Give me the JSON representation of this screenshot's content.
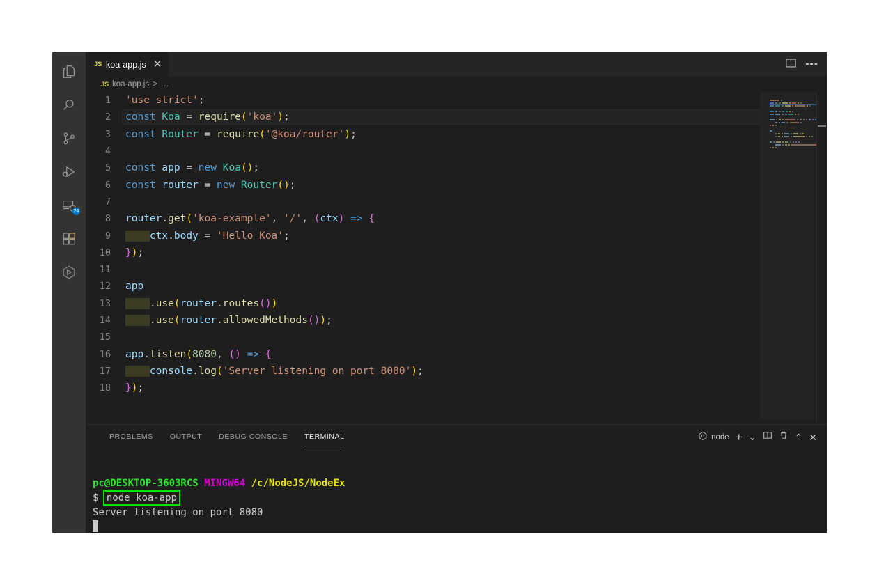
{
  "window": {
    "background": "#1e1e1e",
    "accent": "#007acc"
  },
  "activity_bar": {
    "items": [
      {
        "name": "explorer",
        "icon": "files-icon",
        "badge": ""
      },
      {
        "name": "search",
        "icon": "search-icon",
        "badge": ""
      },
      {
        "name": "source-control",
        "icon": "source-control-icon",
        "badge": ""
      },
      {
        "name": "run-and-debug",
        "icon": "run-debug-icon",
        "badge": ""
      },
      {
        "name": "remote-explorer",
        "icon": "remote-explorer-icon",
        "badge": "24"
      },
      {
        "name": "extensions",
        "icon": "extensions-icon",
        "badge": ""
      },
      {
        "name": "node-dependencies",
        "icon": "hexagon-node-icon",
        "badge": ""
      }
    ]
  },
  "tabbar": {
    "tabs": [
      {
        "label": "koa-app.js",
        "file_type": "JS",
        "active": true,
        "close_glyph": "✕"
      }
    ],
    "actions": {
      "split_editor": "split-editor-icon",
      "more_actions": "•••"
    }
  },
  "breadcrumb": {
    "file_type": "JS",
    "file": "koa-app.js",
    "separator": ">",
    "overflow": "…"
  },
  "editor": {
    "language": "javascript",
    "current_line": 2,
    "total_lines": 18,
    "lines": [
      {
        "n": "1",
        "tokens": [
          {
            "t": "'use strict'",
            "c": "t-str"
          },
          {
            "t": ";",
            "c": "t-plain"
          }
        ]
      },
      {
        "n": "2",
        "current": true,
        "tokens": [
          {
            "t": "const",
            "c": "t-kw"
          },
          {
            "t": " ",
            "c": "t-plain"
          },
          {
            "t": "Koa",
            "c": "t-cls"
          },
          {
            "t": " = ",
            "c": "t-op"
          },
          {
            "t": "require",
            "c": "t-fn"
          },
          {
            "t": "(",
            "c": "t-p1"
          },
          {
            "t": "'koa'",
            "c": "t-str"
          },
          {
            "t": ")",
            "c": "t-p1"
          },
          {
            "t": ";",
            "c": "t-plain"
          }
        ]
      },
      {
        "n": "3",
        "tokens": [
          {
            "t": "const",
            "c": "t-kw"
          },
          {
            "t": " ",
            "c": "t-plain"
          },
          {
            "t": "Router",
            "c": "t-cls"
          },
          {
            "t": " = ",
            "c": "t-op"
          },
          {
            "t": "require",
            "c": "t-fn"
          },
          {
            "t": "(",
            "c": "t-p1"
          },
          {
            "t": "'@koa/router'",
            "c": "t-str"
          },
          {
            "t": ")",
            "c": "t-p1"
          },
          {
            "t": ";",
            "c": "t-plain"
          }
        ]
      },
      {
        "n": "4",
        "tokens": []
      },
      {
        "n": "5",
        "tokens": [
          {
            "t": "const",
            "c": "t-kw"
          },
          {
            "t": " ",
            "c": "t-plain"
          },
          {
            "t": "app",
            "c": "t-var"
          },
          {
            "t": " = ",
            "c": "t-op"
          },
          {
            "t": "new",
            "c": "t-kw"
          },
          {
            "t": " ",
            "c": "t-plain"
          },
          {
            "t": "Koa",
            "c": "t-cls"
          },
          {
            "t": "()",
            "c": "t-p1"
          },
          {
            "t": ";",
            "c": "t-plain"
          }
        ]
      },
      {
        "n": "6",
        "tokens": [
          {
            "t": "const",
            "c": "t-kw"
          },
          {
            "t": " ",
            "c": "t-plain"
          },
          {
            "t": "router",
            "c": "t-var"
          },
          {
            "t": " = ",
            "c": "t-op"
          },
          {
            "t": "new",
            "c": "t-kw"
          },
          {
            "t": " ",
            "c": "t-plain"
          },
          {
            "t": "Router",
            "c": "t-cls"
          },
          {
            "t": "()",
            "c": "t-p1"
          },
          {
            "t": ";",
            "c": "t-plain"
          }
        ]
      },
      {
        "n": "7",
        "tokens": []
      },
      {
        "n": "8",
        "tokens": [
          {
            "t": "router",
            "c": "t-var"
          },
          {
            "t": ".",
            "c": "t-plain"
          },
          {
            "t": "get",
            "c": "t-fn"
          },
          {
            "t": "(",
            "c": "t-p1"
          },
          {
            "t": "'koa-example'",
            "c": "t-str"
          },
          {
            "t": ", ",
            "c": "t-plain"
          },
          {
            "t": "'/'",
            "c": "t-str"
          },
          {
            "t": ", ",
            "c": "t-plain"
          },
          {
            "t": "(",
            "c": "t-p2"
          },
          {
            "t": "ctx",
            "c": "t-var"
          },
          {
            "t": ")",
            "c": "t-p2"
          },
          {
            "t": " ",
            "c": "t-plain"
          },
          {
            "t": "=>",
            "c": "t-kw"
          },
          {
            "t": " ",
            "c": "t-plain"
          },
          {
            "t": "{",
            "c": "t-p2"
          }
        ]
      },
      {
        "n": "9",
        "indent": 1,
        "tokens": [
          {
            "t": "ctx",
            "c": "t-var"
          },
          {
            "t": ".",
            "c": "t-plain"
          },
          {
            "t": "body",
            "c": "t-var"
          },
          {
            "t": " = ",
            "c": "t-op"
          },
          {
            "t": "'Hello Koa'",
            "c": "t-str"
          },
          {
            "t": ";",
            "c": "t-plain"
          }
        ]
      },
      {
        "n": "10",
        "tokens": [
          {
            "t": "}",
            "c": "t-p2"
          },
          {
            "t": ")",
            "c": "t-p1"
          },
          {
            "t": ";",
            "c": "t-plain"
          }
        ]
      },
      {
        "n": "11",
        "tokens": []
      },
      {
        "n": "12",
        "tokens": [
          {
            "t": "app",
            "c": "t-var"
          }
        ]
      },
      {
        "n": "13",
        "indent": 1,
        "tokens": [
          {
            "t": ".",
            "c": "t-plain"
          },
          {
            "t": "use",
            "c": "t-fn"
          },
          {
            "t": "(",
            "c": "t-p1"
          },
          {
            "t": "router",
            "c": "t-var"
          },
          {
            "t": ".",
            "c": "t-plain"
          },
          {
            "t": "routes",
            "c": "t-fn"
          },
          {
            "t": "()",
            "c": "t-p2"
          },
          {
            "t": ")",
            "c": "t-p1"
          }
        ]
      },
      {
        "n": "14",
        "indent": 1,
        "tokens": [
          {
            "t": ".",
            "c": "t-plain"
          },
          {
            "t": "use",
            "c": "t-fn"
          },
          {
            "t": "(",
            "c": "t-p1"
          },
          {
            "t": "router",
            "c": "t-var"
          },
          {
            "t": ".",
            "c": "t-plain"
          },
          {
            "t": "allowedMethods",
            "c": "t-fn"
          },
          {
            "t": "()",
            "c": "t-p2"
          },
          {
            "t": ")",
            "c": "t-p1"
          },
          {
            "t": ";",
            "c": "t-plain"
          }
        ]
      },
      {
        "n": "15",
        "tokens": []
      },
      {
        "n": "16",
        "tokens": [
          {
            "t": "app",
            "c": "t-var"
          },
          {
            "t": ".",
            "c": "t-plain"
          },
          {
            "t": "listen",
            "c": "t-fn"
          },
          {
            "t": "(",
            "c": "t-p1"
          },
          {
            "t": "8080",
            "c": "t-num"
          },
          {
            "t": ", ",
            "c": "t-plain"
          },
          {
            "t": "()",
            "c": "t-p2"
          },
          {
            "t": " ",
            "c": "t-plain"
          },
          {
            "t": "=>",
            "c": "t-kw"
          },
          {
            "t": " ",
            "c": "t-plain"
          },
          {
            "t": "{",
            "c": "t-p2"
          }
        ]
      },
      {
        "n": "17",
        "indent": 1,
        "tokens": [
          {
            "t": "console",
            "c": "t-var"
          },
          {
            "t": ".",
            "c": "t-plain"
          },
          {
            "t": "log",
            "c": "t-fn"
          },
          {
            "t": "(",
            "c": "t-p1"
          },
          {
            "t": "'Server listening on port 8080'",
            "c": "t-str"
          },
          {
            "t": ")",
            "c": "t-p1"
          },
          {
            "t": ";",
            "c": "t-plain"
          }
        ]
      },
      {
        "n": "18",
        "tokens": [
          {
            "t": "}",
            "c": "t-p2"
          },
          {
            "t": ")",
            "c": "t-p1"
          },
          {
            "t": ";",
            "c": "t-plain"
          }
        ]
      }
    ]
  },
  "panel": {
    "tabs": [
      {
        "label": "PROBLEMS",
        "active": false
      },
      {
        "label": "OUTPUT",
        "active": false
      },
      {
        "label": "DEBUG CONSOLE",
        "active": false
      },
      {
        "label": "TERMINAL",
        "active": true
      }
    ],
    "actions": {
      "shell_label": "node",
      "shell_icon": "node-hexagon-icon",
      "new_terminal": "+",
      "new_terminal_dropdown": "⌄",
      "split_terminal": "split-terminal-icon",
      "kill_terminal": "trash-icon",
      "maximize_panel": "⌃",
      "close_panel": "✕"
    }
  },
  "terminal": {
    "prompt_user": "pc@DESKTOP-3603RCS",
    "prompt_host": "MINGW64",
    "prompt_path": "/c/NodeJS/NodeEx",
    "prompt_symbol": "$",
    "command": "node koa-app",
    "command_highlight_color": "#00e600",
    "output": "Server listening on port 8080"
  }
}
